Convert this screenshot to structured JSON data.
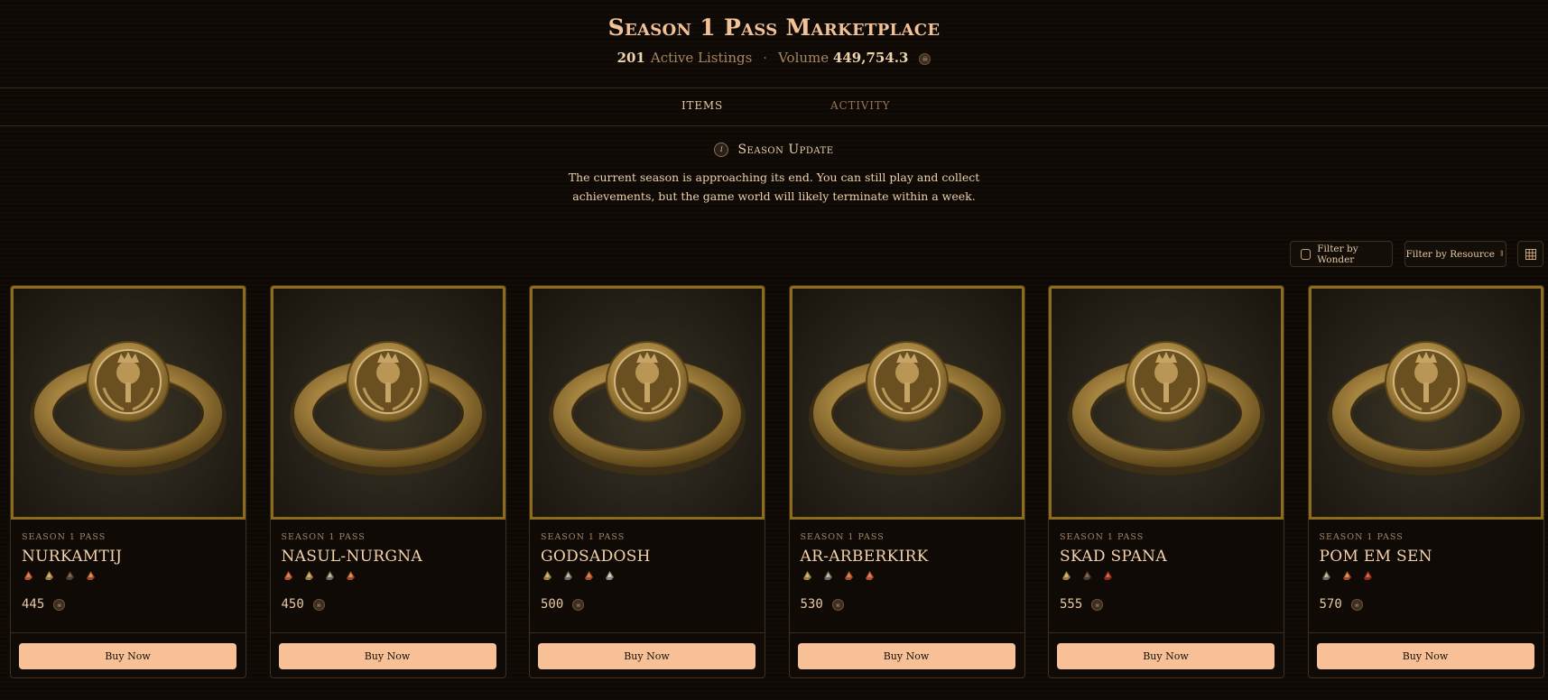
{
  "header": {
    "title": "Season 1 Pass Marketplace",
    "listings_count": "201",
    "listings_label": "Active Listings",
    "separator": "·",
    "volume_label": "Volume",
    "volume_value": "449,754.3"
  },
  "tabs": [
    {
      "label": "Items",
      "active": true
    },
    {
      "label": "Activity",
      "active": false
    }
  ],
  "notice": {
    "title": "Season Update",
    "body": "The current season is approaching its end. You can still play and collect achievements, but the game world will likely terminate within a week."
  },
  "filters": {
    "wonder_label": "Filter by Wonder",
    "resource_label": "Filter by Resource",
    "resource_chevron": "⇕",
    "view_icon": "grid-icon"
  },
  "colors": {
    "background": "#0e0905",
    "accent": "#f7c097",
    "gold_frame": "#8c6b1c",
    "title": "#f2c197"
  },
  "cards": [
    {
      "subtitle": "Season 1 Pass",
      "name": "Nurkamtij",
      "price": "445",
      "button": "Buy Now",
      "resources": [
        "copper",
        "gold",
        "coal",
        "wood"
      ]
    },
    {
      "subtitle": "Season 1 Pass",
      "name": "Nasul-Nurgna",
      "price": "450",
      "button": "Buy Now",
      "resources": [
        "copper",
        "gold",
        "stone",
        "wood"
      ]
    },
    {
      "subtitle": "Season 1 Pass",
      "name": "Godsadosh",
      "price": "500",
      "button": "Buy Now",
      "resources": [
        "gold",
        "stone",
        "crate",
        "silver"
      ]
    },
    {
      "subtitle": "Season 1 Pass",
      "name": "Ar-Arberkirk",
      "price": "530",
      "button": "Buy Now",
      "resources": [
        "gold",
        "stone",
        "crate",
        "copper"
      ]
    },
    {
      "subtitle": "Season 1 Pass",
      "name": "Skad Spana",
      "price": "555",
      "button": "Buy Now",
      "resources": [
        "gold",
        "coal",
        "ruby"
      ]
    },
    {
      "subtitle": "Season 1 Pass",
      "name": "Pom Em Sen",
      "price": "570",
      "button": "Buy Now",
      "resources": [
        "stone",
        "wood",
        "ruby"
      ]
    }
  ]
}
